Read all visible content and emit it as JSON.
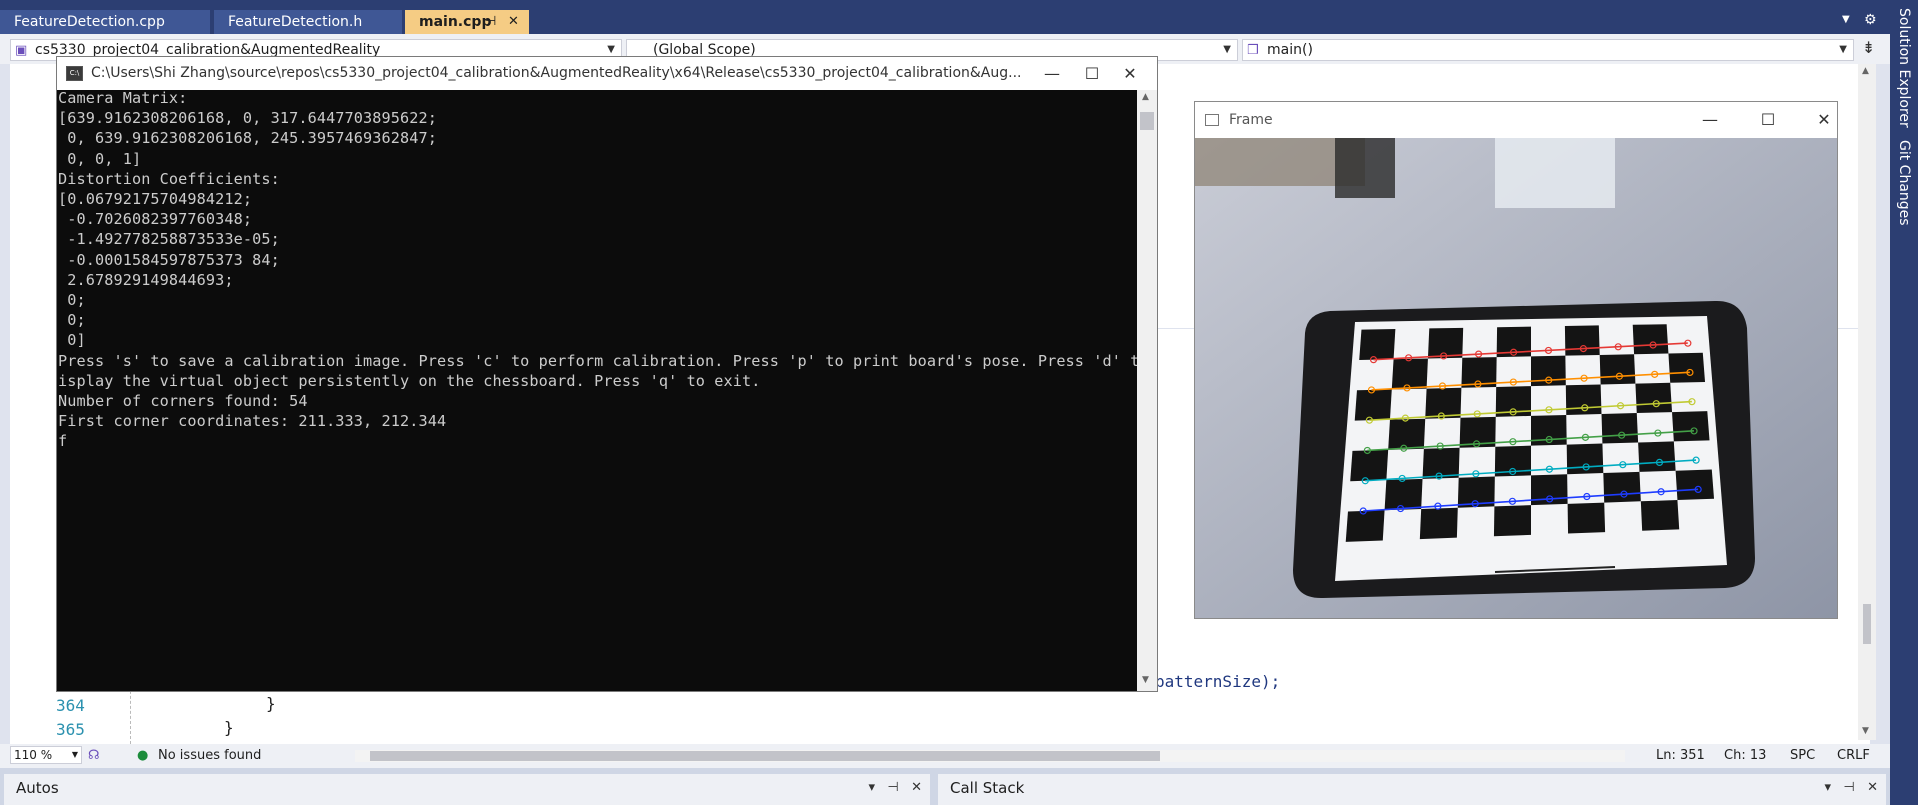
{
  "tabs": {
    "featuredetection_cpp": "FeatureDetection.cpp",
    "featuredetection_h": "FeatureDetection.h",
    "main_cpp": "main.cpp"
  },
  "navbar": {
    "project": "cs5330_project04_calibration&AugmentedReality",
    "scope": "(Global Scope)",
    "member": "main()"
  },
  "side_tools": {
    "solution_explorer": "Solution Explorer",
    "git_changes": "Git Changes"
  },
  "editor": {
    "visible_code_fragment": "patternSize);",
    "lines": [
      {
        "num": "364",
        "code": "}"
      },
      {
        "num": "365",
        "code": "}"
      }
    ]
  },
  "console": {
    "title": "C:\\Users\\Shi Zhang\\source\\repos\\cs5330_project04_calibration&AugmentedReality\\x64\\Release\\cs5330_project04_calibration&Aug...",
    "lines": [
      "Camera Matrix:",
      "[639.9162308206168, 0, 317.6447703895622;",
      " 0, 639.9162308206168, 245.3957469362847;",
      " 0, 0, 1]",
      "Distortion Coefficients:",
      "[0.06792175704984212;",
      " -0.7026082397760348;",
      " -1.492778258873533e-05;",
      " -0.0001584597875373 84;",
      " 2.678929149844693;",
      " 0;",
      " 0;",
      " 0]",
      "Press 's' to save a calibration image. Press 'c' to perform calibration. Press 'p' to print board's pose. Press 'd' to d",
      "isplay the virtual object persistently on the chessboard. Press 'q' to exit.",
      "Number of corners found: 54",
      "First corner coordinates: 211.333, 212.344",
      "f"
    ]
  },
  "frame_window": {
    "title": "Frame"
  },
  "status": {
    "zoom": "110 %",
    "issues": "No issues found",
    "line": "Ln: 351",
    "col": "Ch: 13",
    "spc": "SPC",
    "eol": "CRLF"
  },
  "panes": {
    "autos": "Autos",
    "call_stack": "Call Stack"
  },
  "colors": {
    "tab_strip": "#2c3e72",
    "active_tab": "#f5cc84",
    "console_bg": "#0c0c0c",
    "console_text": "#cccccc"
  }
}
